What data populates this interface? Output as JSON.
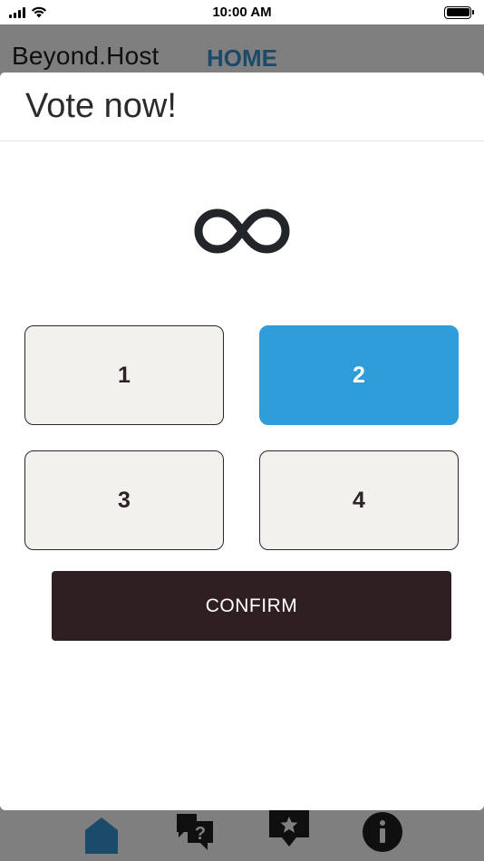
{
  "status_bar": {
    "time": "10:00 AM"
  },
  "background_app": {
    "brand": "Beyond.Host",
    "nav_label": "HOME",
    "tabs": [
      {
        "icon": "home-icon"
      },
      {
        "icon": "question-chat-icon"
      },
      {
        "icon": "star-chat-icon"
      },
      {
        "icon": "info-icon"
      }
    ]
  },
  "modal": {
    "title": "Vote now!",
    "symbol_icon": "infinity-icon",
    "options": [
      "1",
      "2",
      "3",
      "4"
    ],
    "selected_option": "2",
    "confirm_label": "CONFIRM"
  },
  "colors": {
    "accent": "#309ddb",
    "confirm_bg": "#2f1f22",
    "option_bg": "#f2f1ee",
    "overlay": "#7f7f7f",
    "nav_home": "#1c4a6a"
  }
}
